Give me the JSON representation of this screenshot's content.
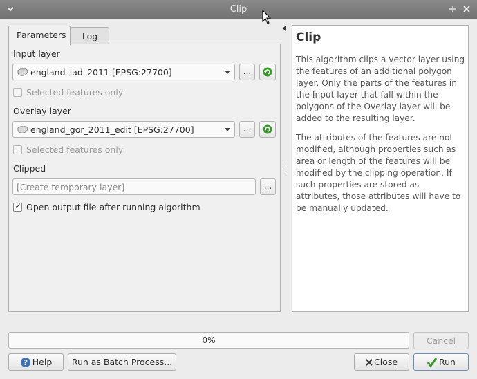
{
  "window": {
    "title": "Clip"
  },
  "tabs": [
    {
      "label": "Parameters",
      "active": true
    },
    {
      "label": "Log",
      "active": false
    }
  ],
  "params": {
    "input_layer_label": "Input layer",
    "input_layer_value": "england_lad_2011 [EPSG:27700]",
    "input_selected_only": "Selected features only",
    "overlay_layer_label": "Overlay layer",
    "overlay_layer_value": "england_gor_2011_edit [EPSG:27700]",
    "overlay_selected_only": "Selected features only",
    "clipped_label": "Clipped",
    "clipped_placeholder": "[Create temporary layer]",
    "open_output_label": "Open output file after running algorithm",
    "open_output_checked": true,
    "browse_label": "..."
  },
  "help": {
    "title": "Clip",
    "paragraph1": "This algorithm clips a vector layer using the features of an additional polygon layer. Only the parts of the features in the Input layer that fall within the polygons of the Overlay layer will be added to the resulting layer.",
    "paragraph2": "The attributes of the features are not modified, although properties such as area or length of the features will be modified by the clipping operation. If such properties are stored as attributes, those attributes will have to be manually updated."
  },
  "progress": {
    "text": "0%",
    "value": 0
  },
  "buttons": {
    "cancel": "Cancel",
    "help": "Help",
    "batch": "Run as Batch Process...",
    "close_prefix": "",
    "close": "Close",
    "run": "Run"
  },
  "colors": {
    "titlebar": "#7d7d7d",
    "accent_green": "#3a9a2c",
    "help_blue": "#3b6fb6"
  }
}
